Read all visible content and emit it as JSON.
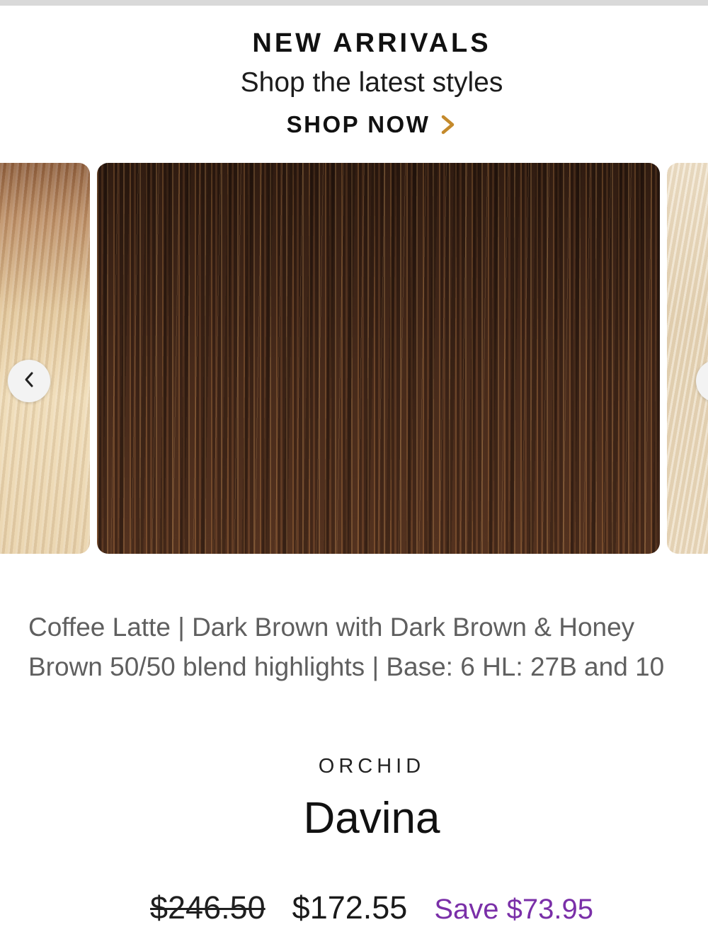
{
  "promo": {
    "heading": "NEW ARRIVALS",
    "subheading": "Shop the latest styles",
    "cta_label": "SHOP NOW",
    "cta_icon": "chevron-right-icon",
    "cta_icon_color": "#c48a2c"
  },
  "carousel": {
    "prev_icon": "chevron-left-icon",
    "next_icon": "chevron-right-icon"
  },
  "product": {
    "color_description": "Coffee Latte | Dark Brown with Dark Brown & Honey Brown 50/50 blend highlights | Base: 6 HL: 27B and 10",
    "brand": "ORCHID",
    "name": "Davina",
    "price_original": "$246.50",
    "price_sale": "$172.55",
    "savings": "Save $73.95",
    "savings_color": "#7a2fa8"
  }
}
